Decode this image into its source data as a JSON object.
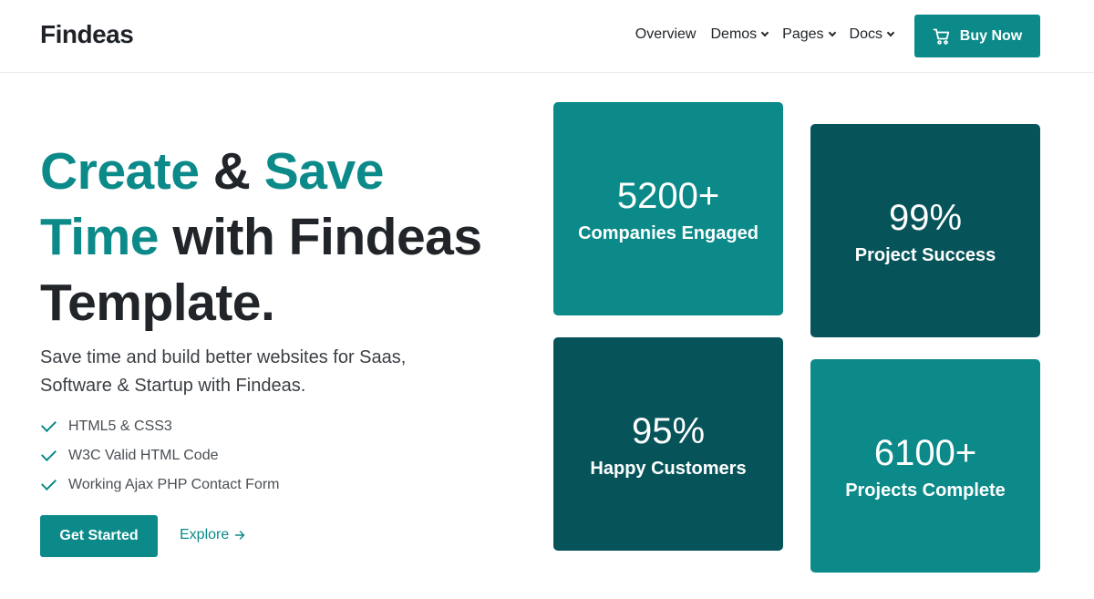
{
  "header": {
    "logo": "Findeas",
    "nav": [
      {
        "label": "Overview",
        "dropdown": false
      },
      {
        "label": "Demos",
        "dropdown": true
      },
      {
        "label": "Pages",
        "dropdown": true
      },
      {
        "label": "Docs",
        "dropdown": true
      }
    ],
    "buy_label": "Buy Now",
    "buy_icon": "cart-icon"
  },
  "hero": {
    "title_part1": "Create",
    "title_part2": " & ",
    "title_part3": "Save",
    "title_part4": "Time",
    "title_part5": " with Findeas",
    "title_part6": "Template.",
    "lead": "Save time and build better websites for Saas, Software & Startup with Findeas.",
    "features": [
      "HTML5 & CSS3",
      "W3C Valid HTML Code",
      "Working Ajax PHP Contact Form"
    ],
    "primary_button": "Get Started",
    "secondary_link": "Explore",
    "secondary_icon": "arrow-right-icon"
  },
  "stats": [
    {
      "value": "5200+",
      "label": "Companies Engaged"
    },
    {
      "value": "99%",
      "label": "Project Success"
    },
    {
      "value": "95%",
      "label": "Happy Customers"
    },
    {
      "value": "6100+",
      "label": "Projects Complete"
    }
  ],
  "colors": {
    "accent": "#0b8a89",
    "dark_accent": "#06545a",
    "text": "#212529"
  }
}
